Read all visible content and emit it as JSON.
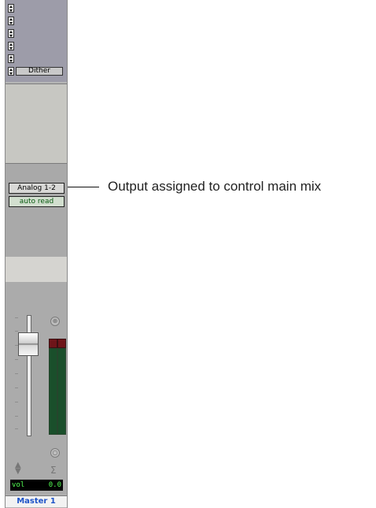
{
  "channel": {
    "inserts": [
      "",
      "",
      "",
      "",
      "Dither"
    ],
    "output": "Analog 1-2",
    "automation": "auto read",
    "volume_label": "vol",
    "volume_value": "0.0",
    "name": "Master 1"
  },
  "annotation": {
    "text": "Output assigned to control main mix"
  },
  "colors": {
    "insert_bg": "#9d9ca9",
    "strip_bg": "#b5b5b5",
    "meter_green": "#1a4f2b",
    "name_blue": "#1d53c8"
  },
  "icons": [
    "up-down-arrow-icon",
    "pan-knob-icon",
    "group-icon",
    "sigma-icon"
  ]
}
